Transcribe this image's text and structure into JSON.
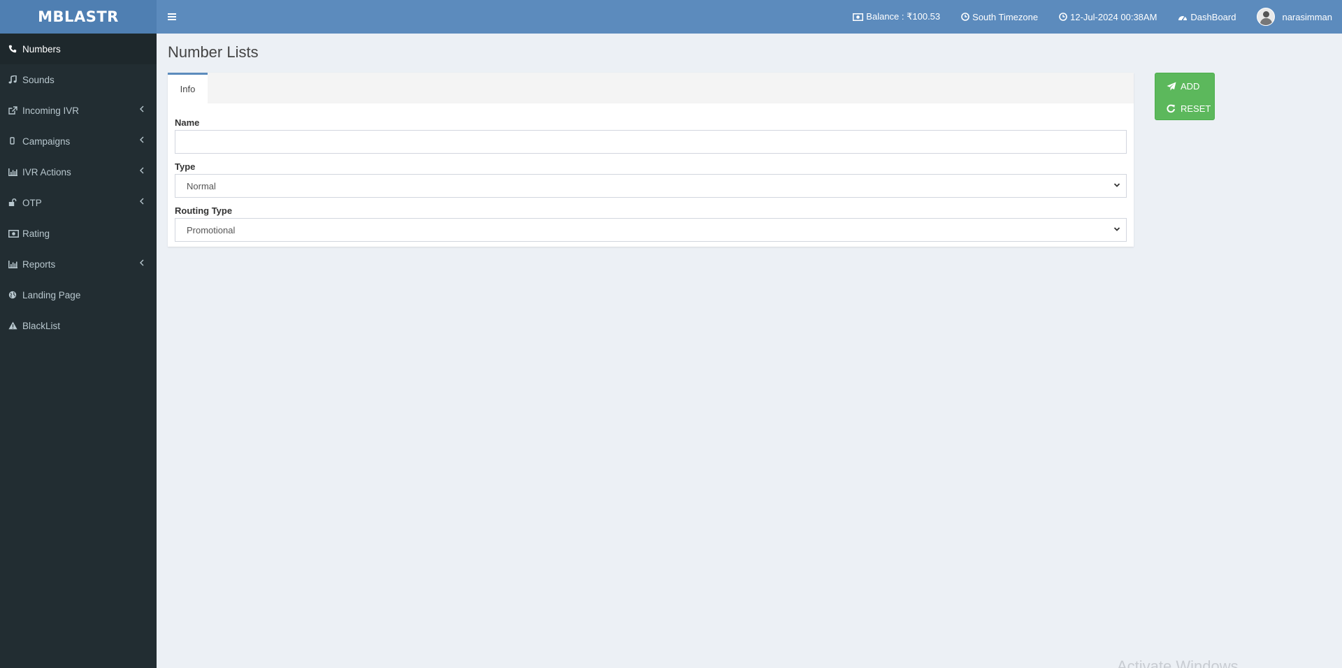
{
  "header": {
    "logo": "MBLASTR",
    "balance": "Balance : ₹100.53",
    "timezone": "South Timezone",
    "datetime": "12-Jul-2024 00:38AM",
    "dashboard": "DashBoard",
    "username": "narasimman"
  },
  "sidebar": {
    "items": [
      {
        "label": "Numbers",
        "icon": "phone-icon",
        "active": true
      },
      {
        "label": "Sounds",
        "icon": "music-icon"
      },
      {
        "label": "Incoming IVR",
        "icon": "external-link-icon",
        "expandable": true
      },
      {
        "label": "Campaigns",
        "icon": "mobile-icon",
        "expandable": true
      },
      {
        "label": "IVR Actions",
        "icon": "bar-chart-icon",
        "expandable": true
      },
      {
        "label": "OTP",
        "icon": "unlock-icon",
        "expandable": true
      },
      {
        "label": "Rating",
        "icon": "money-icon"
      },
      {
        "label": "Reports",
        "icon": "bar-chart-icon",
        "expandable": true
      },
      {
        "label": "Landing Page",
        "icon": "globe-icon"
      },
      {
        "label": "BlackList",
        "icon": "warning-icon"
      }
    ]
  },
  "main": {
    "title": "Number Lists",
    "tab": "Info",
    "fields": {
      "name": {
        "label": "Name",
        "value": ""
      },
      "type": {
        "label": "Type",
        "value": "Normal"
      },
      "routing_type": {
        "label": "Routing Type",
        "value": "Promotional"
      }
    }
  },
  "actions": {
    "add": "ADD",
    "reset": "RESET"
  },
  "watermark": "Activate Windows",
  "colors": {
    "header": "#5c8bbd",
    "sidebar": "#222d32",
    "button": "#5cb85c"
  }
}
